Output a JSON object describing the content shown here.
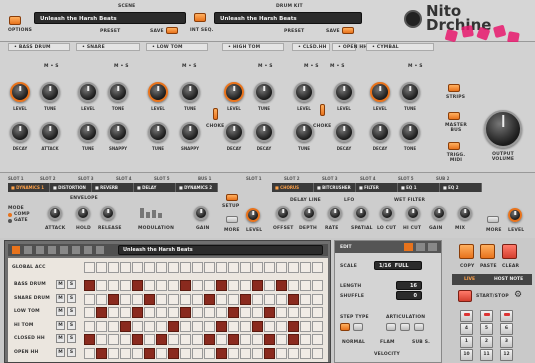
{
  "header": {
    "scene_label": "SCENE",
    "scene_value": "Unleash the Harsh Beats",
    "options_label": "OPTIONS",
    "preset_label": "PRESET",
    "save_label": "SAVE",
    "int_seq_label": "INT SEQ.",
    "drum_kit_label": "DRUM KIT",
    "drum_kit_value": "Unleash the Harsh Beats",
    "preset2_label": "PRESET",
    "save2_label": "SAVE",
    "brand_line1": "Nit",
    "brand_line2": "Dr",
    "brand_tail1": "o",
    "brand_tail2": "chine"
  },
  "instruments": [
    {
      "name": "BASS DRUM",
      "knobs": [
        "LEVEL",
        "TUNE",
        "DECAY",
        "ATTACK"
      ]
    },
    {
      "name": "SNARE",
      "knobs": [
        "LEVEL",
        "TONE",
        "TUNE",
        "SNAPPY"
      ]
    },
    {
      "name": "LOW TOM",
      "knobs": [
        "LEVEL",
        "TUNE",
        "TUNE",
        "SNAPPY"
      ]
    },
    {
      "name": "HIGH TOM",
      "knobs": [
        "LEVEL",
        "TUNE",
        "DECAY",
        "DECAY"
      ]
    },
    {
      "name": "CLSD.HH",
      "knobs": [
        "LEVEL",
        "TUNE",
        "DECAY"
      ]
    },
    {
      "name": "OPEN HH",
      "knobs": [
        "LEVEL",
        "DECAY"
      ]
    },
    {
      "name": "CYMBAL",
      "knobs": [
        "LEVEL",
        "TUNE",
        "DECAY",
        "TONE"
      ]
    }
  ],
  "extra_labels": {
    "choke1": "CHOKE",
    "choke2": "CHOKE",
    "strips": "STRIPS",
    "master_bus": "MASTER BUS",
    "trigg_midi": "TRIGG. MIDI",
    "output_volume": "OUTPUT VOLUME",
    "m": "M",
    "s": "S"
  },
  "fx": {
    "slots": [
      "SLOT 1",
      "SLOT 2",
      "SLOT 3",
      "SLOT 4",
      "SLOT 5",
      "BUS 1",
      "SLOT 1",
      "SLOT 2",
      "SLOT 3",
      "SLOT 4",
      "SLOT 5",
      "SUB 2"
    ],
    "left_chain": [
      "DYNAMICS 1",
      "DISTORTION",
      "REVERB",
      "DELAY",
      "DYNAMICS 2"
    ],
    "right_chain": [
      "CHORUS",
      "BITCRUSHER",
      "FILTER",
      "EQ 1",
      "EQ 2"
    ],
    "mode_label": "MODE",
    "comp_label": "COMP",
    "gate_label": "GATE",
    "envelope_label": "ENVELOPE",
    "attack": "ATTACK",
    "hold": "HOLD",
    "release": "RELEASE",
    "modulation": "MODULATION",
    "gain": "GAIN",
    "setup": "SETUP",
    "more": "MORE",
    "level": "LEVEL",
    "delay_line": "DELAY LINE",
    "lfo": "LFO",
    "wet_filter": "WET FILTER",
    "offset": "OFFSET",
    "depth": "DEPTH",
    "rate": "RATE",
    "spatial": "SPATIAL",
    "lo_cut": "LO CUT",
    "hi_cut": "HI CUT",
    "gain2": "GAIN",
    "mix": "MIX",
    "more2": "MORE",
    "level2": "LEVEL"
  },
  "sequencer": {
    "pattern_name": "Unleash the Harsh Beats",
    "global_acc": "GLOBAL ACC",
    "rows": [
      "BASS DRUM",
      "SNARE DRUM",
      "LOW TOM",
      "HI TOM",
      "CLOSED HH",
      "OPEN HH"
    ],
    "m": "M",
    "s": "S",
    "pattern": [
      [
        1,
        0,
        0,
        0,
        1,
        0,
        0,
        0,
        1,
        0,
        0,
        1,
        0,
        0,
        1,
        0,
        1,
        0,
        0,
        0
      ],
      [
        0,
        0,
        1,
        0,
        0,
        1,
        0,
        0,
        0,
        0,
        1,
        0,
        0,
        1,
        0,
        0,
        0,
        1,
        0,
        0
      ],
      [
        0,
        1,
        0,
        0,
        1,
        0,
        0,
        0,
        1,
        0,
        0,
        0,
        1,
        0,
        0,
        1,
        0,
        0,
        0,
        0
      ],
      [
        0,
        0,
        0,
        1,
        0,
        0,
        0,
        1,
        0,
        0,
        0,
        1,
        0,
        0,
        1,
        0,
        0,
        1,
        0,
        0
      ],
      [
        1,
        0,
        0,
        0,
        1,
        0,
        1,
        0,
        0,
        0,
        1,
        0,
        1,
        0,
        0,
        1,
        0,
        1,
        0,
        0
      ],
      [
        0,
        1,
        0,
        0,
        0,
        1,
        0,
        1,
        0,
        0,
        0,
        1,
        0,
        0,
        0,
        1,
        0,
        0,
        0,
        0
      ]
    ]
  },
  "edit": {
    "title": "EDIT",
    "scale_label": "SCALE",
    "scale_value": "1/16",
    "scale_full": "FULL",
    "length_label": "LENGTH",
    "length_value": "16",
    "shuffle_label": "SHUFFLE",
    "shuffle_value": "0",
    "step_type": "STEP TYPE",
    "articulation": "ARTICULATION",
    "normal": "NORMAL",
    "flam": "FLAM",
    "sub_s": "SUB S.",
    "velocity": "VELOCITY"
  },
  "right_panel": {
    "copy": "COPY",
    "paste": "PASTE",
    "clear": "CLEAR",
    "live": "LIVE",
    "host_note": "HOST NOTE",
    "start_stop": "START/STOP",
    "pads": [
      "7",
      "8",
      "9",
      "4",
      "5",
      "6",
      "1",
      "2",
      "3",
      "10",
      "11",
      "12"
    ]
  },
  "colors": {
    "accent": "#e8731c",
    "step_on": "#8a2a1e",
    "step_off": "#f1ece6"
  }
}
